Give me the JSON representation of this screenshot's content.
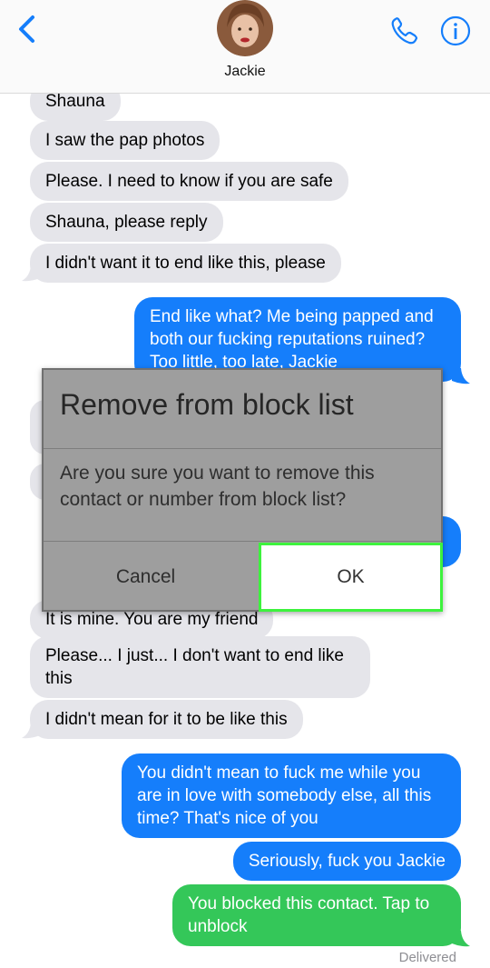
{
  "header": {
    "contact_name": "Jackie",
    "icons": [
      "back-chevron-icon",
      "avatar",
      "phone-icon",
      "info-icon"
    ],
    "accent_color": "#157efb"
  },
  "messages": [
    {
      "dir": "in",
      "text": "Shauna"
    },
    {
      "dir": "in",
      "text": "I saw the pap photos"
    },
    {
      "dir": "in",
      "text": "Please. I need to know if you are safe"
    },
    {
      "dir": "in",
      "text": "Shauna, please reply"
    },
    {
      "dir": "in",
      "text": "I didn't want it to end like this, please"
    },
    {
      "dir": "out",
      "text": "End like what? Me being papped and both our fucking reputations ruined? Too little, too late, Jackie"
    },
    {
      "dir": "in",
      "text": "It is mine. You are my friend"
    },
    {
      "dir": "in",
      "text": "Please... I just... I don't want to end like this"
    },
    {
      "dir": "in",
      "text": "I didn't mean for it to be like this"
    },
    {
      "dir": "out",
      "text": "You didn't mean to fuck me while you are in love with somebody else, all this time? That's nice of you"
    },
    {
      "dir": "out",
      "text": "Seriously, fuck you Jackie"
    },
    {
      "dir": "status",
      "text": "You blocked this contact. Tap to unblock"
    }
  ],
  "delivered_label": "Delivered",
  "dialog": {
    "title": "Remove from block list",
    "message": "Are you sure you want to remove this contact or number from block list?",
    "cancel_label": "Cancel",
    "ok_label": "OK"
  },
  "colors": {
    "incoming_bubble": "#e5e5ea",
    "outgoing_bubble": "#157efb",
    "status_bubble": "#34c759",
    "highlight": "#3df23d"
  }
}
